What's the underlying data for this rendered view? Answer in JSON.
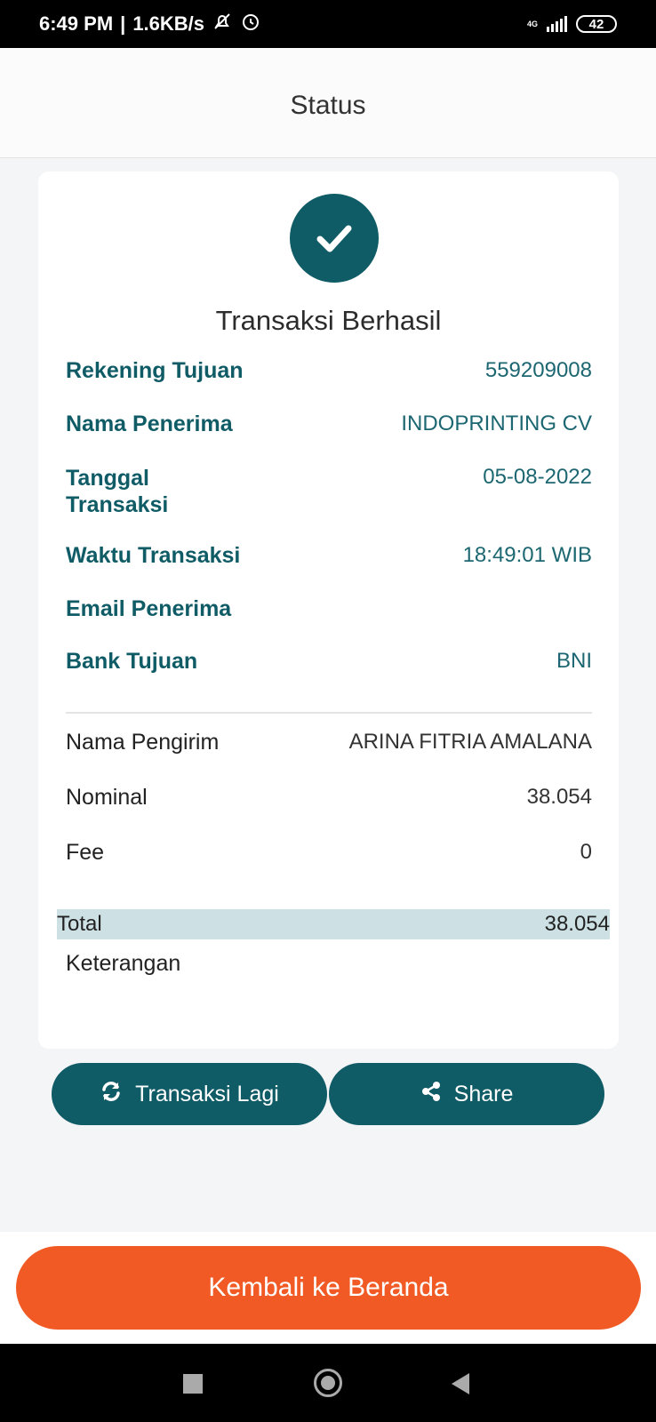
{
  "status_bar": {
    "time": "6:49 PM",
    "speed": "1.6KB/s",
    "network": "4G",
    "battery": "42"
  },
  "header": {
    "title": "Status"
  },
  "card": {
    "title": "Transaksi Berhasil",
    "recipient_rows": [
      {
        "label": "Rekening Tujuan",
        "value": "559209008"
      },
      {
        "label": "Nama Penerima",
        "value": "INDOPRINTING CV"
      },
      {
        "label": "Tanggal Transaksi",
        "value": "05-08-2022"
      },
      {
        "label": "Waktu Transaksi",
        "value": "18:49:01 WIB"
      },
      {
        "label": "Email Penerima",
        "value": ""
      },
      {
        "label": "Bank Tujuan",
        "value": "BNI"
      }
    ],
    "sender_rows": [
      {
        "label": "Nama Pengirim",
        "value": "ARINA FITRIA AMALANA"
      },
      {
        "label": "Nominal",
        "value": "38.054"
      },
      {
        "label": "Fee",
        "value": "0"
      }
    ],
    "total": {
      "label": "Total",
      "value": "38.054"
    },
    "note": {
      "label": "Keterangan",
      "value": ""
    }
  },
  "actions": {
    "repeat_label": "Transaksi Lagi",
    "share_label": "Share"
  },
  "footer": {
    "home_label": "Kembali ke Beranda"
  },
  "colors": {
    "primary": "#0f5b66",
    "accent": "#f15a24",
    "total_highlight": "#cde0e3"
  }
}
